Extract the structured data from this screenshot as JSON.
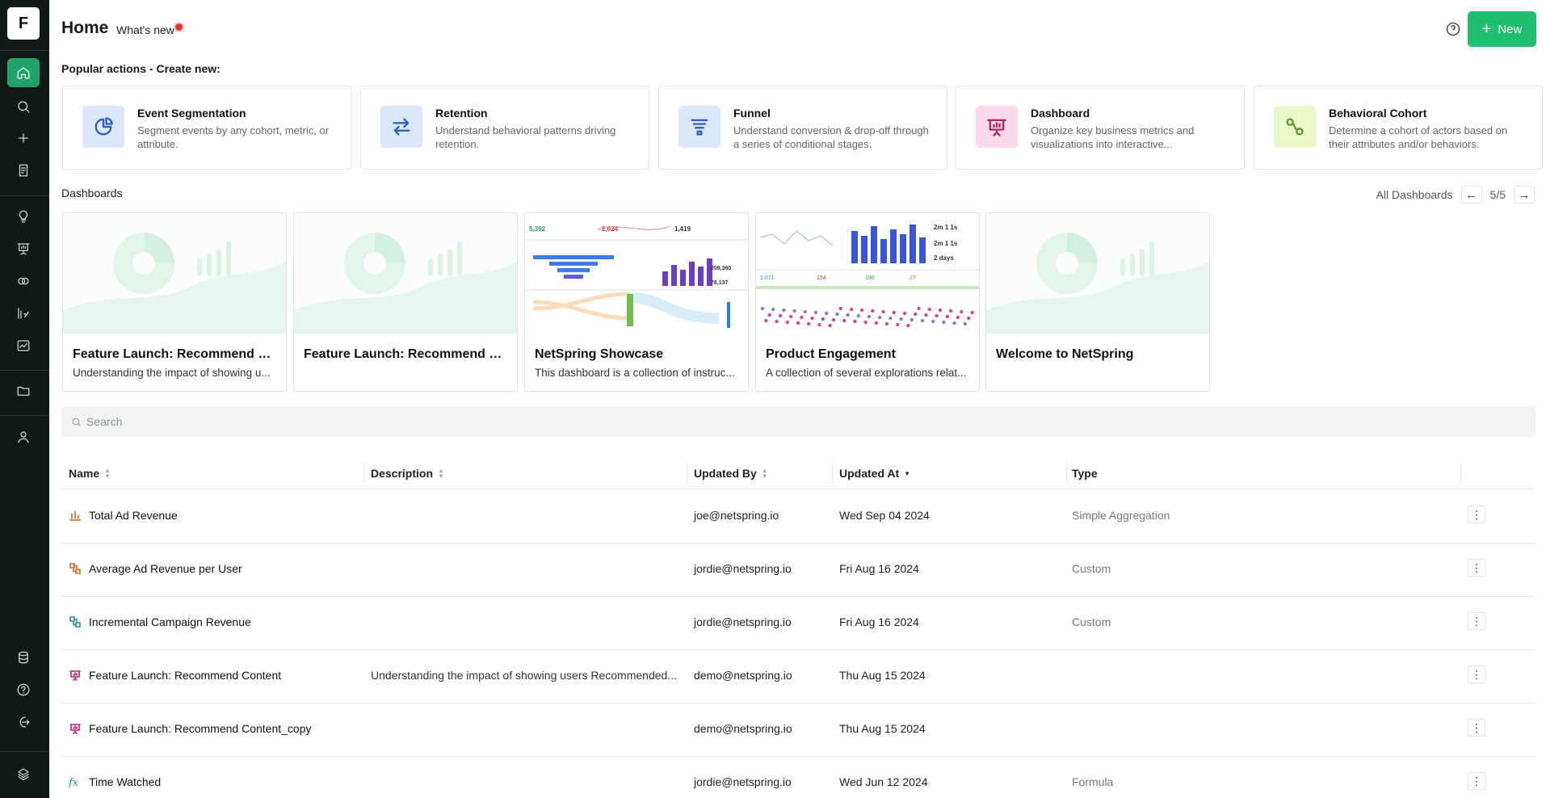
{
  "app": {
    "logo_letter": "F"
  },
  "sidebar": {
    "items": [
      {
        "name": "home",
        "icon": "home-icon"
      },
      {
        "name": "search",
        "icon": "search-icon"
      },
      {
        "name": "create",
        "icon": "plus-icon"
      },
      {
        "name": "reports",
        "icon": "document-icon"
      },
      {
        "name": "insights",
        "icon": "lightbulb-icon"
      },
      {
        "name": "dashboards",
        "icon": "presentation-icon"
      },
      {
        "name": "cohorts",
        "icon": "circles-icon"
      },
      {
        "name": "metrics",
        "icon": "function-icon"
      },
      {
        "name": "analytics",
        "icon": "chart-icon"
      },
      {
        "name": "folders",
        "icon": "folder-icon"
      },
      {
        "name": "users",
        "icon": "user-icon"
      },
      {
        "name": "data",
        "icon": "database-icon"
      },
      {
        "name": "help",
        "icon": "help-icon"
      },
      {
        "name": "logout",
        "icon": "logout-icon"
      },
      {
        "name": "brand",
        "icon": "netspring-logo-icon"
      }
    ]
  },
  "header": {
    "title": "Home",
    "whats_new": "What's new",
    "new_button": "New",
    "new_button_plus": "+"
  },
  "popular": {
    "label": "Popular actions - Create new:",
    "actions": [
      {
        "title": "Event Segmentation",
        "desc": "Segment events by any cohort, metric, or attribute.",
        "icon": "pie-icon",
        "bg": "#dbe7fb",
        "stroke": "#2f5fbf"
      },
      {
        "title": "Retention",
        "desc": "Understand behavioral patterns driving retention.",
        "icon": "swap-icon",
        "bg": "#dbe7fb",
        "stroke": "#2f5fbf"
      },
      {
        "title": "Funnel",
        "desc": "Understand conversion & drop-off through a series of conditional stages.",
        "icon": "funnel-icon",
        "bg": "#dbe7fb",
        "stroke": "#2f5fbf"
      },
      {
        "title": "Dashboard",
        "desc": "Organize key business metrics and visualizations into interactive...",
        "icon": "presentation-icon",
        "bg": "#fbd7ea",
        "stroke": "#b0276c"
      },
      {
        "title": "Behavioral Cohort",
        "desc": "Determine a cohort of actors based on their attributes and/or behaviors.",
        "icon": "cohort-icon",
        "bg": "#eaf8c8",
        "stroke": "#5a9a2a"
      }
    ]
  },
  "dashboards": {
    "label": "Dashboards",
    "all_label": "All Dashboards",
    "prev": "←",
    "next": "→",
    "page": "5/5",
    "items": [
      {
        "title": "Feature Launch: Recommend Con...",
        "desc": "Understanding the impact of showing u...",
        "thumb": "placeholder"
      },
      {
        "title": "Feature Launch: Recommend Con...",
        "desc": "",
        "thumb": "placeholder"
      },
      {
        "title": "NetSpring Showcase",
        "desc": "This dashboard is a collection of instruc...",
        "thumb": "showcase"
      },
      {
        "title": "Product Engagement",
        "desc": "A collection of several explorations relat...",
        "thumb": "engagement"
      },
      {
        "title": "Welcome to NetSpring",
        "desc": "",
        "thumb": "placeholder"
      }
    ]
  },
  "search": {
    "placeholder": "Search"
  },
  "table": {
    "columns": [
      "Name",
      "Description",
      "Updated By",
      "Updated At",
      "Type"
    ],
    "rows": [
      {
        "icon": "aggregation-icon",
        "icon_color": "#d8641f",
        "name": "Total Ad Revenue",
        "description": "",
        "updated_by": "joe@netspring.io",
        "updated_at": "Wed Sep 04 2024",
        "type": "Simple Aggregation",
        "menu": "⋮"
      },
      {
        "icon": "custom-metric-icon",
        "icon_color": "#d8641f",
        "name": "Average Ad Revenue per User",
        "description": "",
        "updated_by": "jordie@netspring.io",
        "updated_at": "Fri Aug 16 2024",
        "type": "Custom",
        "menu": "⋮"
      },
      {
        "icon": "custom-metric-icon",
        "icon_color": "#1b8f9a",
        "name": "Incremental Campaign Revenue",
        "description": "",
        "updated_by": "jordie@netspring.io",
        "updated_at": "Fri Aug 16 2024",
        "type": "Custom",
        "menu": "⋮"
      },
      {
        "icon": "dashboard-icon",
        "icon_color": "#b0276c",
        "name": "Feature Launch: Recommend Content",
        "description": "Understanding the impact of showing users Recommended...",
        "updated_by": "demo@netspring.io",
        "updated_at": "Thu Aug 15 2024",
        "type": "",
        "menu": "⋮"
      },
      {
        "icon": "dashboard-icon",
        "icon_color": "#b0276c",
        "name": "Feature Launch: Recommend Content_copy",
        "description": "",
        "updated_by": "demo@netspring.io",
        "updated_at": "Thu Aug 15 2024",
        "type": "",
        "menu": "⋮"
      },
      {
        "icon": "formula-icon",
        "icon_color": "#1b8f9a",
        "name": "Time Watched",
        "description": "",
        "updated_by": "jordie@netspring.io",
        "updated_at": "Wed Jun 12 2024",
        "type": "Formula",
        "menu": "⋮"
      }
    ]
  }
}
